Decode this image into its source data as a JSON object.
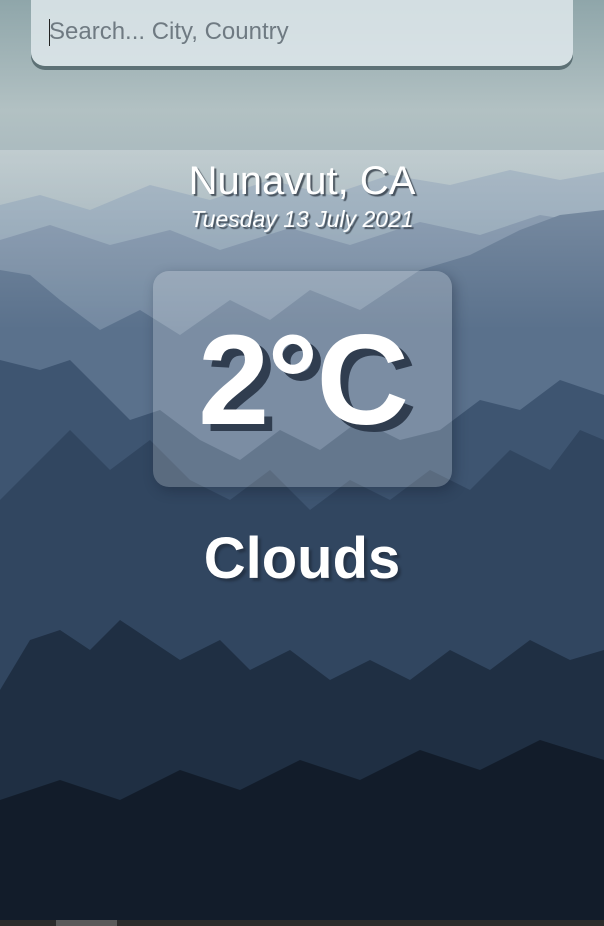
{
  "search": {
    "placeholder": "Search... City, Country",
    "value": ""
  },
  "weather": {
    "location": "Nunavut, CA",
    "date": "Tuesday 13 July 2021",
    "temperature": "2°C",
    "condition": "Clouds"
  },
  "theme": {
    "sky_top": "#aebcc0",
    "mountains_far": "#7f93a6",
    "mountains_mid": "#4d6580",
    "mountains_near": "#1f3044",
    "text": "#ffffff"
  }
}
